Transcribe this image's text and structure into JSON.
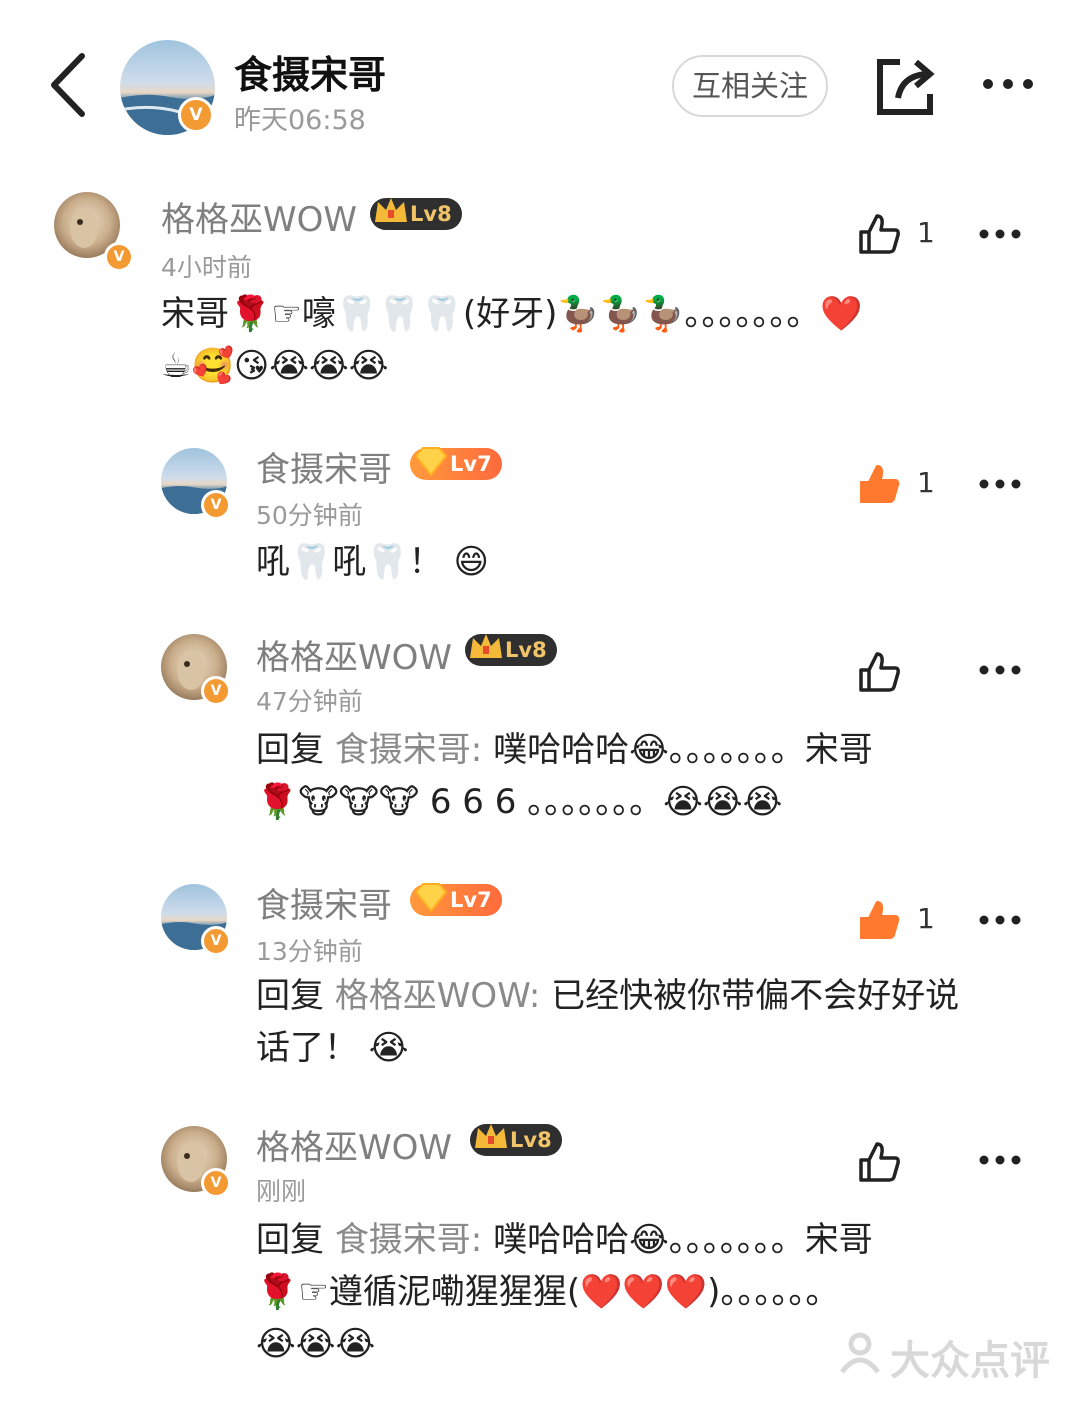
{
  "header": {
    "author_name": "食摄宋哥",
    "post_time": "昨天06:58",
    "follow_label": "互相关注",
    "verified_mark": "V"
  },
  "colors": {
    "accent_orange": "#f39a32",
    "liked_orange": "#ff7a2f",
    "gray_text": "#9a9a9a"
  },
  "comments": [
    {
      "user": "格格巫WOW",
      "level": "Lv8",
      "time": "4小时前",
      "likes": "1",
      "liked": false,
      "text_line1": "宋哥🌹☞嚎🦷🦷🦷(好牙)🦆🦆🦆。。。。。。。❤️",
      "text_line2": "☕🥰😘😭😭😭"
    },
    {
      "user": "食摄宋哥",
      "level": "Lv7",
      "time": "50分钟前",
      "likes": "1",
      "liked": true,
      "text_line1": "吼🦷吼🦷！ 😄"
    },
    {
      "user": "格格巫WOW",
      "level": "Lv8",
      "time": "47分钟前",
      "liked": false,
      "reply_prefix": "回复 ",
      "reply_to": "食摄宋哥: ",
      "text_line1": "噗哈哈哈😂。。。。。。。宋哥",
      "text_line2": "🌹🐮🐮🐮 6 6 6 。。。。。。。😭😭😭"
    },
    {
      "user": "食摄宋哥",
      "level": "Lv7",
      "time": "13分钟前",
      "likes": "1",
      "liked": true,
      "reply_prefix": "回复 ",
      "reply_to": "格格巫WOW: ",
      "text_line1": "已经快被你带偏不会好好说",
      "text_line2": "话了！ 😭"
    },
    {
      "user": "格格巫WOW",
      "level": "Lv8",
      "time": "刚刚",
      "liked": false,
      "reply_prefix": "回复 ",
      "reply_to": "食摄宋哥: ",
      "text_line1": "噗哈哈哈😂。。。。。。。宋哥",
      "text_line2": "🌹☞遵循泥嘞猩猩猩(❤️❤️❤️)。。。。。。",
      "text_line3": "😭😭😭"
    }
  ],
  "watermark": "大众点评",
  "icons": [
    "back-arrow-icon",
    "share-icon",
    "more-icon",
    "like-icon",
    "verified-icon",
    "crown-icon",
    "diamond-icon"
  ]
}
